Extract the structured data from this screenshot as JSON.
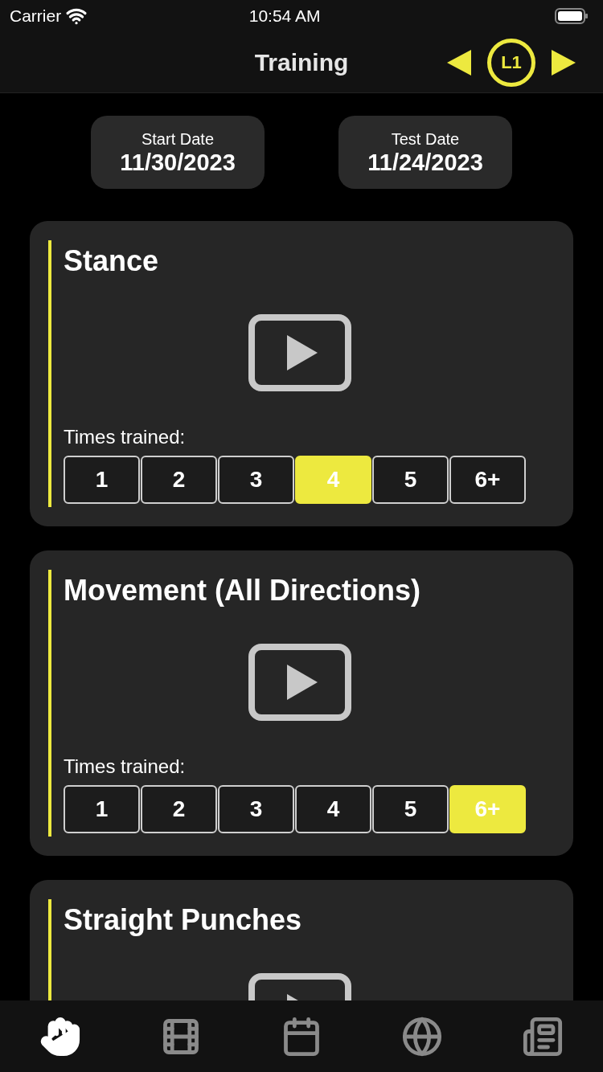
{
  "status_bar": {
    "carrier": "Carrier",
    "time": "10:54 AM"
  },
  "header": {
    "title": "Training",
    "level_badge": "L1"
  },
  "dates": [
    {
      "label": "Start Date",
      "value": "11/30/2023"
    },
    {
      "label": "Test Date",
      "value": "11/24/2023"
    }
  ],
  "drills": [
    {
      "title": "Stance",
      "times_label": "Times trained:",
      "options": [
        {
          "label": "1",
          "selected": false
        },
        {
          "label": "2",
          "selected": false
        },
        {
          "label": "3",
          "selected": false
        },
        {
          "label": "4",
          "selected": true
        },
        {
          "label": "5",
          "selected": false
        },
        {
          "label": "6+",
          "selected": false
        }
      ]
    },
    {
      "title": "Movement (All Directions)",
      "times_label": "Times trained:",
      "options": [
        {
          "label": "1",
          "selected": false
        },
        {
          "label": "2",
          "selected": false
        },
        {
          "label": "3",
          "selected": false
        },
        {
          "label": "4",
          "selected": false
        },
        {
          "label": "5",
          "selected": false
        },
        {
          "label": "6+",
          "selected": true
        }
      ]
    },
    {
      "title": "Straight Punches"
    }
  ],
  "tab_bar": [
    {
      "kind": "fist",
      "selected": true
    },
    {
      "kind": "film",
      "selected": false
    },
    {
      "kind": "calendar",
      "selected": false
    },
    {
      "kind": "globe",
      "selected": false
    },
    {
      "kind": "newspaper",
      "selected": false
    }
  ]
}
